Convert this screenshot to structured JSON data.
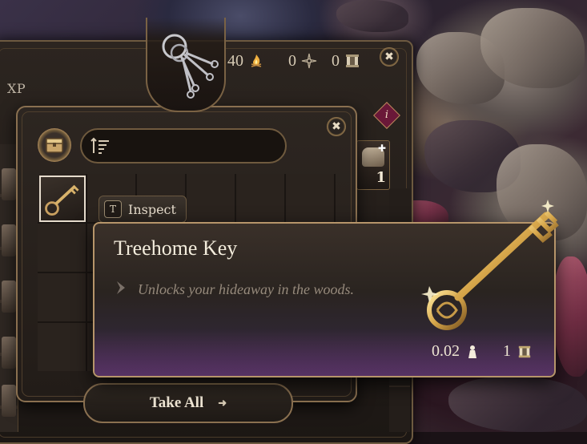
{
  "currency": {
    "camp_supplies": "40",
    "inspiration": "0",
    "weight_units": "0"
  },
  "character_panel": {
    "xp_label": "XP",
    "stack_count": "1",
    "info_badge": "i"
  },
  "container": {
    "header_icon": "keyring-icon",
    "inspect_key": "T",
    "inspect_label": "Inspect",
    "take_all_label": "Take All",
    "selected_item_icon": "key-icon"
  },
  "tooltip": {
    "title": "Treehome Key",
    "description": "Unlocks your hideaway in the woods.",
    "weight": "0.02",
    "value": "1"
  },
  "colors": {
    "panel_border": "#8a7050",
    "tooltip_border": "#b6956a",
    "tooltip_purple": "#4a2d54",
    "gold": "#e0b85a"
  }
}
